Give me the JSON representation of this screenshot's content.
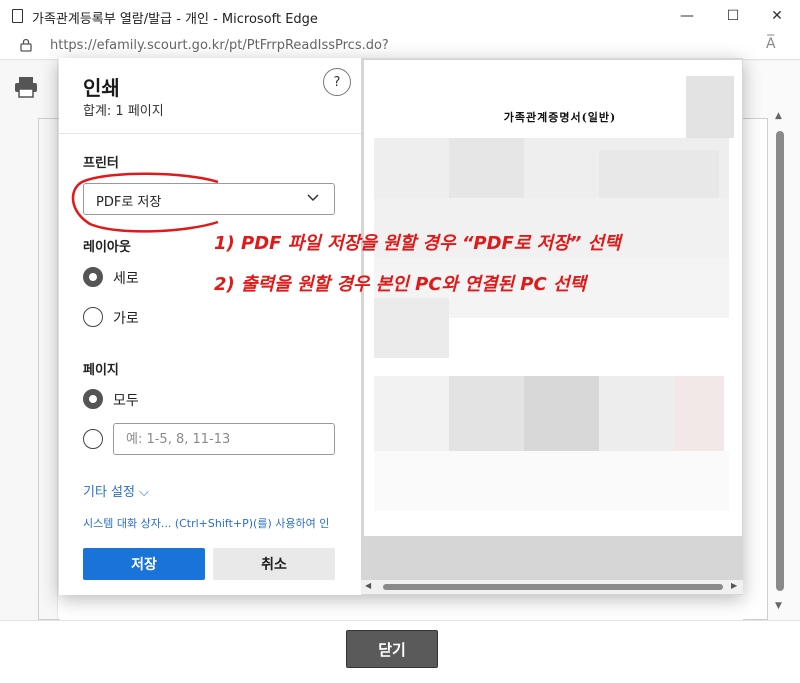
{
  "window": {
    "title": "가족관계등록부 열람/발급 - 개인 - Microsoft Edge",
    "url": "https://efamily.scourt.go.kr/pt/PtFrrpReadIssPrcs.do?",
    "minimize_glyph": "—",
    "maximize_glyph": "☐",
    "close_glyph": "✕",
    "read_aloud_glyph": "A̅"
  },
  "print_dialog": {
    "title": "인쇄",
    "total": "합계: 1 페이지",
    "help_glyph": "?",
    "printer_label": "프린터",
    "printer_value": "PDF로 저장",
    "layout_label": "레이아웃",
    "layout_options": [
      "세로",
      "가로"
    ],
    "layout_selected": "세로",
    "pages_label": "페이지",
    "pages_options": [
      "모두"
    ],
    "pages_selected": "모두",
    "pages_placeholder": "예: 1-5, 8, 11-13",
    "more_settings": "기타 설정 ⌵",
    "system_dialog_link": "시스템 대화 상자... (Ctrl+Shift+P)(를) 사용하여 인",
    "save_button": "저장",
    "cancel_button": "취소"
  },
  "preview": {
    "document_title": "가족관계증명서(일반)"
  },
  "annotation": {
    "line1": "1) PDF 파일 저장을 원할 경우 “PDF로 저장” 선택",
    "line2": "2) 출력을 원할 경우 본인 PC와 연결된 PC 선택",
    "color": "#e01919"
  },
  "page_footer": {
    "close_button": "닫기"
  },
  "icons": {
    "printer": "printer-icon",
    "lock": "lock-icon",
    "document": "document-icon",
    "chevron": "chevron-down-icon"
  }
}
